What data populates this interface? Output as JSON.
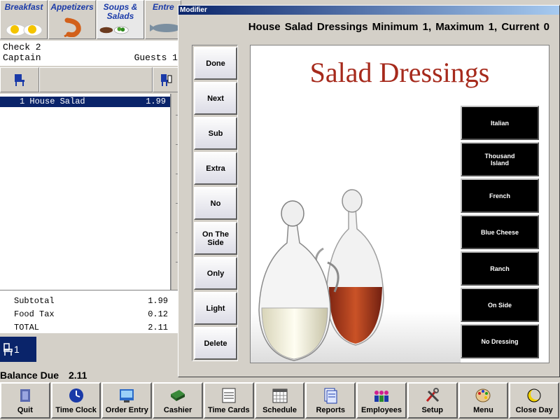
{
  "categories": [
    {
      "label": "Breakfast",
      "icon": "eggs-icon"
    },
    {
      "label": "Appetizers",
      "icon": "shrimp-icon"
    },
    {
      "label": "Soups & Salads",
      "icon": "salad-icon"
    },
    {
      "label": "Entre",
      "icon": "fish-icon"
    }
  ],
  "check": {
    "number_label": "Check 2",
    "server": "Captain",
    "guests_label": "Guests 1"
  },
  "items": [
    {
      "qty_name": "1 House Salad",
      "price": "1.99"
    }
  ],
  "totals": {
    "subtotal_label": "Subtotal",
    "subtotal": "1.99",
    "tax_label": "Food Tax",
    "tax": "0.12",
    "total_label": "TOTAL",
    "total": "2.11"
  },
  "seat_indicator": "1",
  "balance": {
    "label": "Balance Due",
    "value": "2.11"
  },
  "dialog": {
    "title": "Modifier",
    "header": "House Salad  Dressings  Minimum 1, Maximum 1, Current 0",
    "art_title": "Salad Dressings",
    "modifier_buttons": [
      "Done",
      "Next",
      "Sub",
      "Extra",
      "No",
      "On The Side",
      "Only",
      "Light",
      "Delete"
    ],
    "options": [
      "Italian",
      "Thousand Island",
      "French",
      "Blue Cheese",
      "Ranch",
      "On Side",
      "No Dressing"
    ]
  },
  "toolbar": [
    {
      "label": "Quit",
      "icon": "quit-icon"
    },
    {
      "label": "Time Clock",
      "icon": "clock-icon"
    },
    {
      "label": "Order Entry",
      "icon": "order-entry-icon"
    },
    {
      "label": "Cashier",
      "icon": "cash-drawer-icon"
    },
    {
      "label": "Time Cards",
      "icon": "time-cards-icon"
    },
    {
      "label": "Schedule",
      "icon": "calendar-icon"
    },
    {
      "label": "Reports",
      "icon": "reports-icon"
    },
    {
      "label": "Employees",
      "icon": "employees-icon"
    },
    {
      "label": "Setup",
      "icon": "setup-tools-icon"
    },
    {
      "label": "Menu",
      "icon": "palette-icon"
    },
    {
      "label": "Close Day",
      "icon": "moon-icon"
    }
  ],
  "colors": {
    "selection": "#0a246a",
    "title_red": "#a62a1c",
    "tab_text": "#1a3aa8"
  }
}
